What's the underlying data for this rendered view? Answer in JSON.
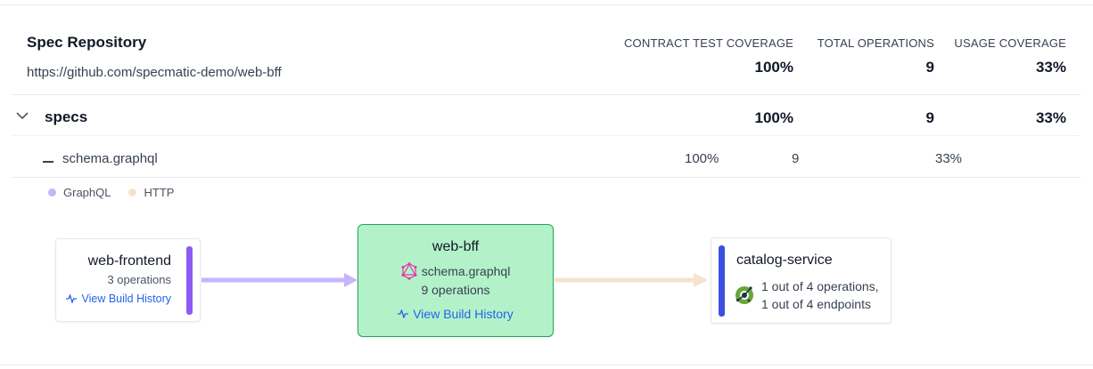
{
  "repository": {
    "title": "Spec Repository",
    "url": "https://github.com/specmatic-demo/web-bff"
  },
  "columns": {
    "contract_test_coverage": "CONTRACT TEST COVERAGE",
    "total_operations": "TOTAL OPERATIONS",
    "usage_coverage": "USAGE COVERAGE"
  },
  "repo_totals": {
    "contract": "100%",
    "operations": "9",
    "usage": "33%"
  },
  "specs_group": {
    "label": "specs",
    "contract": "100%",
    "operations": "9",
    "usage": "33%",
    "expanded": true
  },
  "spec_file": {
    "label": "schema.graphql",
    "contract": "100%",
    "operations": "9",
    "usage": "33%"
  },
  "legend": [
    {
      "label": "GraphQL",
      "color": "#c4b5fd"
    },
    {
      "label": "HTTP",
      "color": "#f5e3cf"
    }
  ],
  "graph": {
    "consumer": {
      "name": "web-frontend",
      "operations": "3 operations",
      "history_link": "View Build History",
      "accent": "#8b5cf6"
    },
    "service": {
      "name": "web-bff",
      "spec": "schema.graphql",
      "operations": "9 operations",
      "history_link": "View Build History",
      "fill": "#b3f2c9",
      "border": "#22a35a"
    },
    "dependency": {
      "name": "catalog-service",
      "line1": "1 out of 4 operations,",
      "line2": "1 out of 4 endpoints",
      "accent": "#3b4fe0"
    },
    "edges": [
      {
        "from": "web-frontend",
        "to": "web-bff",
        "protocol": "GraphQL",
        "color": "#c4b5fd"
      },
      {
        "from": "web-bff",
        "to": "catalog-service",
        "protocol": "HTTP",
        "color": "#f5e3cf"
      }
    ]
  },
  "icons": {
    "expand": "chevron-down-icon",
    "collapse": "minus-icon",
    "history": "activity-icon",
    "graphql": "graphql-icon",
    "openapi": "openapi-icon"
  }
}
